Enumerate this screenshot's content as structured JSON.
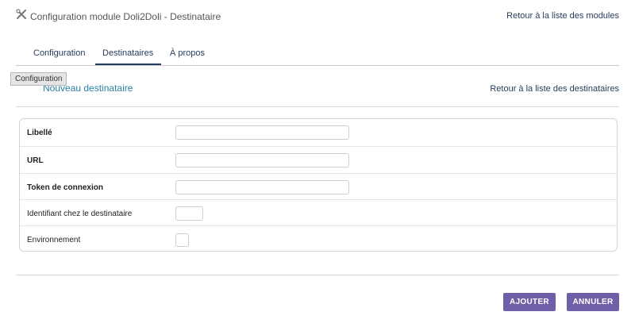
{
  "header": {
    "title": "Configuration module Doli2Doli - Destinataire",
    "back_link": "Retour à la liste des modules",
    "icon": "tools-icon"
  },
  "tabs": [
    {
      "label": "Configuration",
      "active": false
    },
    {
      "label": "Destinataires",
      "active": true
    },
    {
      "label": "À propos",
      "active": false
    }
  ],
  "tooltip": "Configuration",
  "section": {
    "title": "Nouveau destinataire",
    "back_link": "Retour à la liste des destinataires"
  },
  "form": {
    "fields": [
      {
        "label": "Libellé",
        "required": true,
        "value": ""
      },
      {
        "label": "URL",
        "required": true,
        "value": ""
      },
      {
        "label": "Token de connexion",
        "required": true,
        "value": ""
      },
      {
        "label": "Identifiant chez le destinataire",
        "required": false,
        "value": ""
      },
      {
        "label": "Environnement",
        "required": false,
        "checked": false
      }
    ]
  },
  "buttons": {
    "add": "AJOUTER",
    "cancel": "ANNULER"
  },
  "colors": {
    "button": "#6f5fa6",
    "link": "#263c5c",
    "section_title": "#2a7fa0"
  }
}
